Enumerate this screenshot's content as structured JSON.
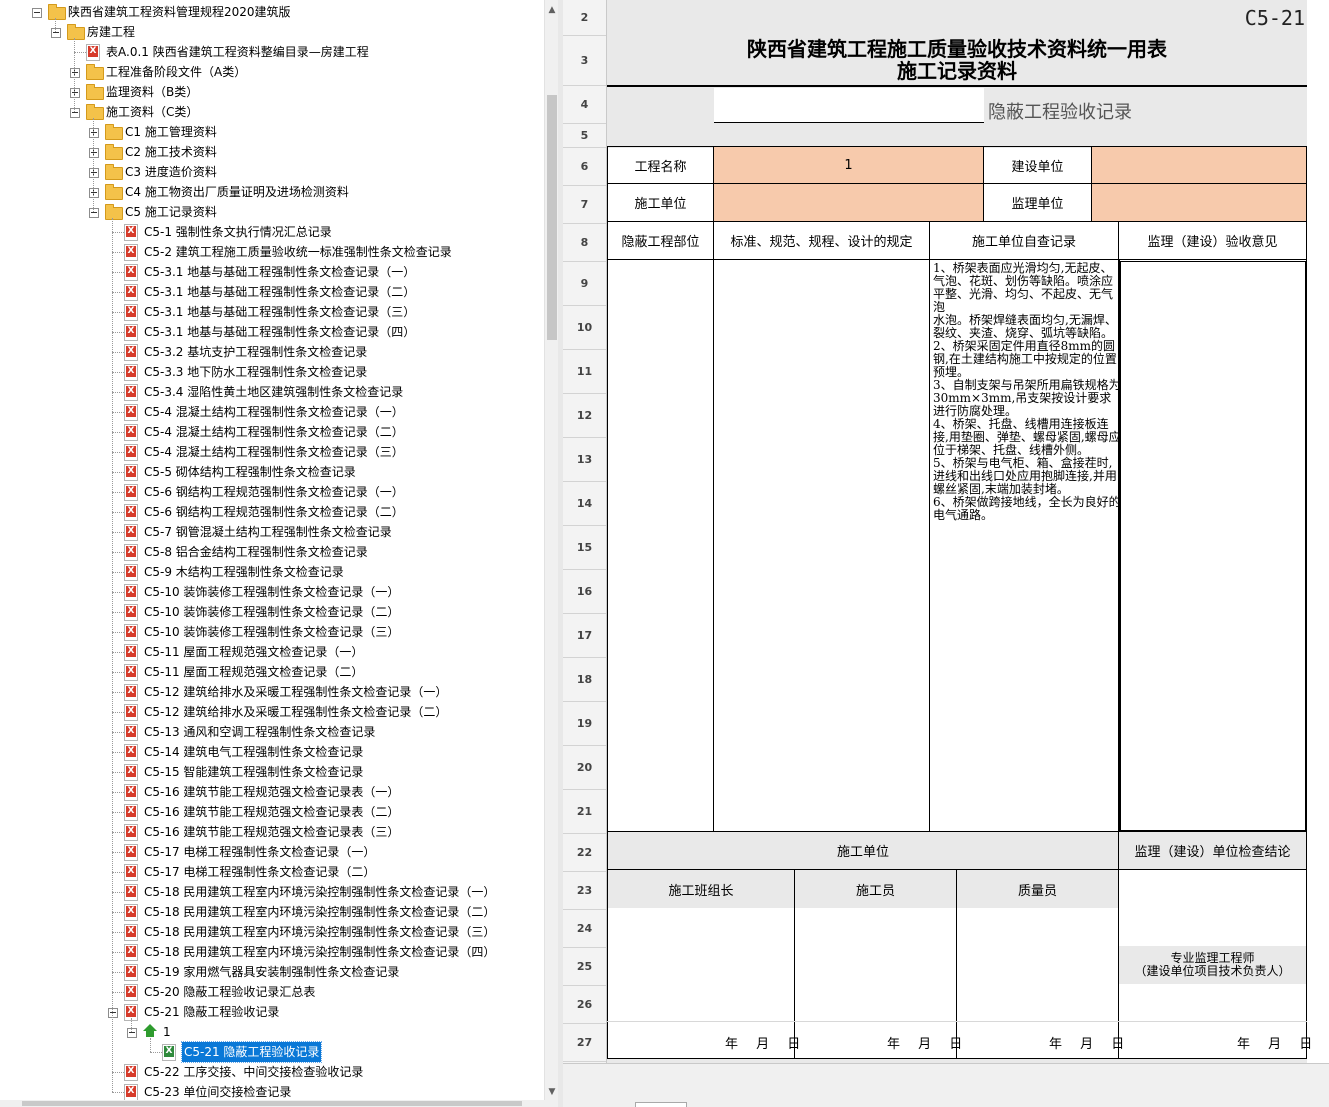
{
  "tree": {
    "items": [
      {
        "label": "陕西省建筑工程资料管理规程2020建筑版",
        "depth": 0,
        "icon": "folder",
        "toggle": "minus"
      },
      {
        "label": "房建工程",
        "depth": 1,
        "icon": "folder",
        "toggle": "minus"
      },
      {
        "label": "表A.0.1 陕西省建筑工程资料整编目录—房建工程",
        "depth": 2,
        "icon": "xls",
        "toggle": ""
      },
      {
        "label": "工程准备阶段文件（A类）",
        "depth": 2,
        "icon": "folder",
        "toggle": "plus"
      },
      {
        "label": "监理资料（B类）",
        "depth": 2,
        "icon": "folder",
        "toggle": "plus"
      },
      {
        "label": "施工资料（C类）",
        "depth": 2,
        "icon": "folder",
        "toggle": "minus"
      },
      {
        "label": "C1 施工管理资料",
        "depth": 3,
        "icon": "folder",
        "toggle": "plus"
      },
      {
        "label": "C2 施工技术资料",
        "depth": 3,
        "icon": "folder",
        "toggle": "plus"
      },
      {
        "label": "C3 进度造价资料",
        "depth": 3,
        "icon": "folder",
        "toggle": "plus"
      },
      {
        "label": "C4 施工物资出厂质量证明及进场检测资料",
        "depth": 3,
        "icon": "folder",
        "toggle": "plus"
      },
      {
        "label": "C5 施工记录资料",
        "depth": 3,
        "icon": "folder",
        "toggle": "minus"
      },
      {
        "label": "C5-1 强制性条文执行情况汇总记录",
        "depth": 4,
        "icon": "xls",
        "toggle": ""
      },
      {
        "label": "C5-2 建筑工程施工质量验收统一标准强制性条文检查记录",
        "depth": 4,
        "icon": "xls",
        "toggle": ""
      },
      {
        "label": "C5-3.1 地基与基础工程强制性条文检查记录（一）",
        "depth": 4,
        "icon": "xls",
        "toggle": ""
      },
      {
        "label": "C5-3.1 地基与基础工程强制性条文检查记录（二）",
        "depth": 4,
        "icon": "xls",
        "toggle": ""
      },
      {
        "label": "C5-3.1 地基与基础工程强制性条文检查记录（三）",
        "depth": 4,
        "icon": "xls",
        "toggle": ""
      },
      {
        "label": "C5-3.1 地基与基础工程强制性条文检查记录（四）",
        "depth": 4,
        "icon": "xls",
        "toggle": ""
      },
      {
        "label": "C5-3.2 基坑支护工程强制性条文检查记录",
        "depth": 4,
        "icon": "xls",
        "toggle": ""
      },
      {
        "label": "C5-3.3 地下防水工程强制性条文检查记录",
        "depth": 4,
        "icon": "xls",
        "toggle": ""
      },
      {
        "label": "C5-3.4 湿陷性黄土地区建筑强制性条文检查记录",
        "depth": 4,
        "icon": "xls",
        "toggle": ""
      },
      {
        "label": "C5-4 混凝土结构工程强制性条文检查记录（一）",
        "depth": 4,
        "icon": "xls",
        "toggle": ""
      },
      {
        "label": "C5-4 混凝土结构工程强制性条文检查记录（二）",
        "depth": 4,
        "icon": "xls",
        "toggle": ""
      },
      {
        "label": "C5-4 混凝土结构工程强制性条文检查记录（三）",
        "depth": 4,
        "icon": "xls",
        "toggle": ""
      },
      {
        "label": "C5-5 砌体结构工程强制性条文检查记录",
        "depth": 4,
        "icon": "xls",
        "toggle": ""
      },
      {
        "label": "C5-6 钢结构工程规范强制性条文检查记录（一）",
        "depth": 4,
        "icon": "xls",
        "toggle": ""
      },
      {
        "label": "C5-6 钢结构工程规范强制性条文检查记录（二）",
        "depth": 4,
        "icon": "xls",
        "toggle": ""
      },
      {
        "label": "C5-7 钢管混凝土结构工程强制性条文检查记录",
        "depth": 4,
        "icon": "xls",
        "toggle": ""
      },
      {
        "label": "C5-8 铝合金结构工程强制性条文检查记录",
        "depth": 4,
        "icon": "xls",
        "toggle": ""
      },
      {
        "label": "C5-9 木结构工程强制性条文检查记录",
        "depth": 4,
        "icon": "xls",
        "toggle": ""
      },
      {
        "label": "C5-10 装饰装修工程强制性条文检查记录（一）",
        "depth": 4,
        "icon": "xls",
        "toggle": ""
      },
      {
        "label": "C5-10 装饰装修工程强制性条文检查记录（二）",
        "depth": 4,
        "icon": "xls",
        "toggle": ""
      },
      {
        "label": "C5-10 装饰装修工程强制性条文检查记录（三）",
        "depth": 4,
        "icon": "xls",
        "toggle": ""
      },
      {
        "label": "C5-11 屋面工程规范强文检查记录（一）",
        "depth": 4,
        "icon": "xls",
        "toggle": ""
      },
      {
        "label": "C5-11 屋面工程规范强文检查记录（二）",
        "depth": 4,
        "icon": "xls",
        "toggle": ""
      },
      {
        "label": "C5-12 建筑给排水及采暖工程强制性条文检查记录（一）",
        "depth": 4,
        "icon": "xls",
        "toggle": ""
      },
      {
        "label": "C5-12 建筑给排水及采暖工程强制性条文检查记录（二）",
        "depth": 4,
        "icon": "xls",
        "toggle": ""
      },
      {
        "label": "C5-13 通风和空调工程强制性条文检查记录",
        "depth": 4,
        "icon": "xls",
        "toggle": ""
      },
      {
        "label": "C5-14 建筑电气工程强制性条文检查记录",
        "depth": 4,
        "icon": "xls",
        "toggle": ""
      },
      {
        "label": "C5-15 智能建筑工程强制性条文检查记录",
        "depth": 4,
        "icon": "xls",
        "toggle": ""
      },
      {
        "label": "C5-16 建筑节能工程规范强文检查记录表（一）",
        "depth": 4,
        "icon": "xls",
        "toggle": ""
      },
      {
        "label": "C5-16 建筑节能工程规范强文检查记录表（二）",
        "depth": 4,
        "icon": "xls",
        "toggle": ""
      },
      {
        "label": "C5-16 建筑节能工程规范强文检查记录表（三）",
        "depth": 4,
        "icon": "xls",
        "toggle": ""
      },
      {
        "label": "C5-17 电梯工程强制性条文检查记录（一）",
        "depth": 4,
        "icon": "xls",
        "toggle": ""
      },
      {
        "label": "C5-17 电梯工程强制性条文检查记录（二）",
        "depth": 4,
        "icon": "xls",
        "toggle": ""
      },
      {
        "label": "C5-18 民用建筑工程室内环境污染控制强制性条文检查记录（一）",
        "depth": 4,
        "icon": "xls",
        "toggle": ""
      },
      {
        "label": "C5-18 民用建筑工程室内环境污染控制强制性条文检查记录（二）",
        "depth": 4,
        "icon": "xls",
        "toggle": ""
      },
      {
        "label": "C5-18 民用建筑工程室内环境污染控制强制性条文检查记录（三）",
        "depth": 4,
        "icon": "xls",
        "toggle": ""
      },
      {
        "label": "C5-18 民用建筑工程室内环境污染控制强制性条文检查记录（四）",
        "depth": 4,
        "icon": "xls",
        "toggle": ""
      },
      {
        "label": "C5-19 家用燃气器具安装制强制性条文检查记录",
        "depth": 4,
        "icon": "xls",
        "toggle": ""
      },
      {
        "label": "C5-20 隐蔽工程验收记录汇总表",
        "depth": 4,
        "icon": "xls",
        "toggle": ""
      },
      {
        "label": "C5-21 隐蔽工程验收记录",
        "depth": 4,
        "icon": "xls",
        "toggle": "minus"
      },
      {
        "label": "1",
        "depth": 5,
        "icon": "home",
        "toggle": "minus"
      },
      {
        "label": "C5-21 隐蔽工程验收记录",
        "depth": 6,
        "icon": "xls-green",
        "toggle": "",
        "selected": true
      },
      {
        "label": "C5-22 工序交接、中间交接检查验收记录",
        "depth": 4,
        "icon": "xls",
        "toggle": ""
      },
      {
        "label": "C5-23 单位间交接检查记录",
        "depth": 4,
        "icon": "xls",
        "toggle": ""
      }
    ]
  },
  "sheet": {
    "row_numbers": [
      "2",
      "3",
      "4",
      "5",
      "6",
      "7",
      "8",
      "9",
      "10",
      "11",
      "12",
      "13",
      "14",
      "15",
      "16",
      "17",
      "18",
      "19",
      "20",
      "21",
      "22",
      "23",
      "24",
      "25",
      "26",
      "27"
    ],
    "form_code": "C5-21",
    "title_line1": "陕西省建筑工程施工质量验收技术资料统一用表",
    "title_line2": "施工记录资料",
    "doc_name": "隐蔽工程验收记录",
    "labels": {
      "project_name": "工程名称",
      "construction_unit": "建设单位",
      "builder_unit": "施工单位",
      "supervisor_unit": "监理单位",
      "hidden_part": "隐蔽工程部位",
      "standards": "标准、规范、规程、设计的规定",
      "self_check": "施工单位自查记录",
      "supervisor_opinion": "监理（建设）验收意见",
      "builder_unit_footer": "施工单位",
      "supervisor_conclusion": "监理（建设）单位检查结论",
      "team_leader": "施工班组长",
      "worker": "施工员",
      "quality_inspector": "质量员",
      "supervising_engineer": "专业监理工程师\n（建设单位项目技术负责人）",
      "date": "年 月 日"
    },
    "values": {
      "project_name": "1",
      "self_check_text": "1、桥架表面应光滑均匀,无起皮、气泡、花斑、划伤等缺陷。喷涂应平整、光滑、均匀、不起皮、无气泡\n水泡。桥架焊缝表面均匀,无漏焊、裂纹、夹渣、烧穿、弧坑等缺陷。\n2、桥架采固定件用直径8mm的圆钢,在土建结构施工中按规定的位置预埋。\n3、自制支架与吊架所用扁铁规格为30mm×3mm,吊支架按设计要求进行防腐处理。\n4、桥架、托盘、线槽用连接板连接,用垫圈、弹垫、螺母紧固,螺母应位于梯架、托盘、线槽外侧。\n5、桥架与电气柜、箱、盒接茬时,进线和出线口处应用抱脚连接,并用螺丝紧固,末端加装封堵。\n6、桥架做跨接地线，全长为良好的电气通路。"
    },
    "colors": {
      "orange_fill": "#f7caac",
      "selection": "#0a78d7"
    }
  }
}
